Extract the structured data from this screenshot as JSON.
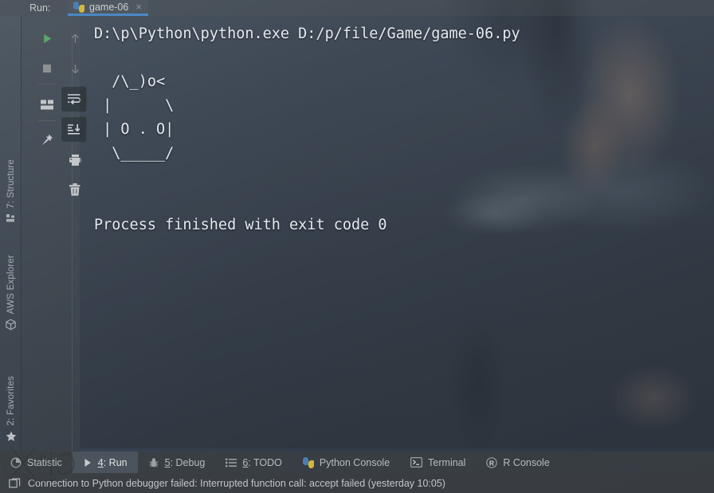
{
  "window": {
    "run_label": "Run:",
    "tab": {
      "title": "game-06",
      "icon": "python-file-icon",
      "close": "×"
    },
    "accent_color": "#4a88c7"
  },
  "run_toolbar": {
    "buttons": [
      {
        "name": "rerun-button",
        "icon": "play-icon",
        "state": "normal"
      },
      {
        "name": "stop-button",
        "icon": "stop-square-icon",
        "state": "normal"
      },
      {
        "name": "show-layout-button",
        "icon": "layout-icon",
        "state": "normal"
      },
      {
        "name": "pin-tab-button",
        "icon": "pin-icon",
        "state": "normal"
      },
      {
        "name": "prev-occurrence-button",
        "icon": "arrow-up-icon",
        "state": "disabled"
      },
      {
        "name": "next-occurrence-button",
        "icon": "arrow-down-icon",
        "state": "disabled"
      },
      {
        "name": "soft-wrap-button",
        "icon": "soft-wrap-icon",
        "state": "active"
      },
      {
        "name": "scroll-to-end-button",
        "icon": "scroll-to-end-icon",
        "state": "active"
      },
      {
        "name": "print-button",
        "icon": "printer-icon",
        "state": "normal"
      },
      {
        "name": "clear-all-button",
        "icon": "trash-icon",
        "state": "normal"
      }
    ]
  },
  "left_strip": {
    "items": [
      {
        "name": "sidebar-item-structure",
        "label": "7: Structure",
        "mnemonic": "7",
        "icon": "structure-icon"
      },
      {
        "name": "sidebar-item-aws-explorer",
        "label": "AWS Explorer",
        "mnemonic": "",
        "icon": "aws-cube-icon"
      },
      {
        "name": "sidebar-item-favorites",
        "label": "2: Favorites",
        "mnemonic": "2",
        "icon": "star-icon"
      }
    ]
  },
  "console": {
    "command_line": "D:\\p\\Python\\python.exe D:/p/file/Game/game-06.py",
    "ascii_art": [
      "  /\\_)o<",
      " |      \\",
      " | O . O|",
      "  \\_____/"
    ],
    "exit_line": "Process finished with exit code 0",
    "exit_code": "0"
  },
  "bottom_bar": {
    "tabs": [
      {
        "name": "bottom-tab-statistic",
        "label": "Statistic",
        "mnemonic": "",
        "icon": "pie-chart-icon",
        "selected": false
      },
      {
        "name": "bottom-tab-run",
        "label": "4: Run",
        "mnemonic": "4",
        "icon": "play-icon",
        "selected": true
      },
      {
        "name": "bottom-tab-debug",
        "label": "5: Debug",
        "mnemonic": "5",
        "icon": "bug-icon",
        "selected": false
      },
      {
        "name": "bottom-tab-todo",
        "label": "6: TODO",
        "mnemonic": "6",
        "icon": "list-icon",
        "selected": false
      },
      {
        "name": "bottom-tab-python-console",
        "label": "Python Console",
        "mnemonic": "",
        "icon": "python-icon",
        "selected": false
      },
      {
        "name": "bottom-tab-terminal",
        "label": "Terminal",
        "mnemonic": "",
        "icon": "terminal-icon",
        "selected": false
      },
      {
        "name": "bottom-tab-r-console",
        "label": "R Console",
        "mnemonic": "",
        "icon": "r-console-icon",
        "selected": false
      }
    ]
  },
  "status_bar": {
    "icon": "event-log-icon",
    "message": "Connection to Python debugger failed: Interrupted function call: accept failed (yesterday 10:05)"
  }
}
